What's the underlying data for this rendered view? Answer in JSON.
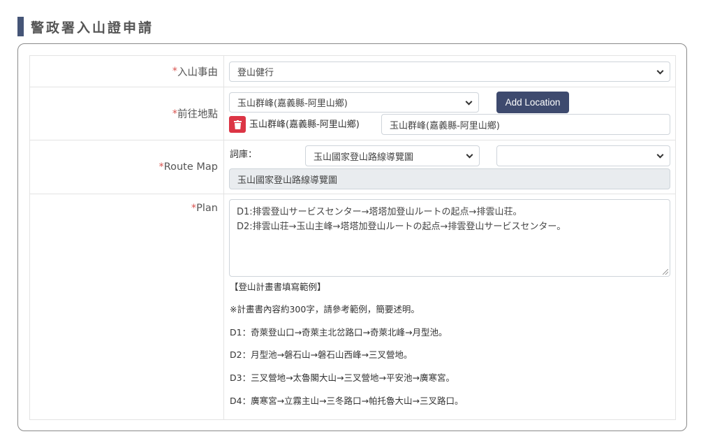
{
  "page": {
    "title": "警政署入山證申請"
  },
  "form": {
    "reason": {
      "required_mark": "* ",
      "label": "入山事由",
      "value": "登山健行"
    },
    "destination": {
      "required_mark": "*",
      "label": "前往地點",
      "select_value": "玉山群峰(嘉義縣-阿里山鄉)",
      "add_button": "Add Location",
      "item_label": "玉山群峰(嘉義縣-阿里山鄉)",
      "item_input_value": "玉山群峰(嘉義縣-阿里山鄉)"
    },
    "route_map": {
      "required_mark": "*",
      "label": "Route Map",
      "lexicon_label": "詞庫：",
      "lexicon_select": "玉山國家登山路線導覽圖",
      "second_select": "",
      "readonly_value": "玉山國家登山路線導覽圖"
    },
    "plan": {
      "required_mark": "*",
      "label": "Plan",
      "text_lines": [
        "D1:排雲登山サービスセンター→塔塔加登山ルートの起点→排雲山荘。",
        "D2:排雲山荘→玉山主峰→塔塔加登山ルートの起点→排雲登山サービスセンター。"
      ],
      "example_lines": [
        "【登山計畫書填寫範例】",
        "※計畫書內容約300字，請參考範例，簡要述明。",
        "D1：奇萊登山口→奇萊主北岔路口→奇萊北峰→月型池。",
        "D2：月型池→磐石山→磐石山西峰→三叉營地。",
        "D3：三叉營地→太魯閣大山→三叉營地→平安池→廣寒宮。",
        "D4：廣寒宮→立霧主山→三冬路口→帕托魯大山→三叉路口。"
      ]
    }
  },
  "colors": {
    "header_bar": "#455577",
    "button": "#3e4a6e",
    "danger": "#dc3545",
    "required": "#d9534f"
  }
}
